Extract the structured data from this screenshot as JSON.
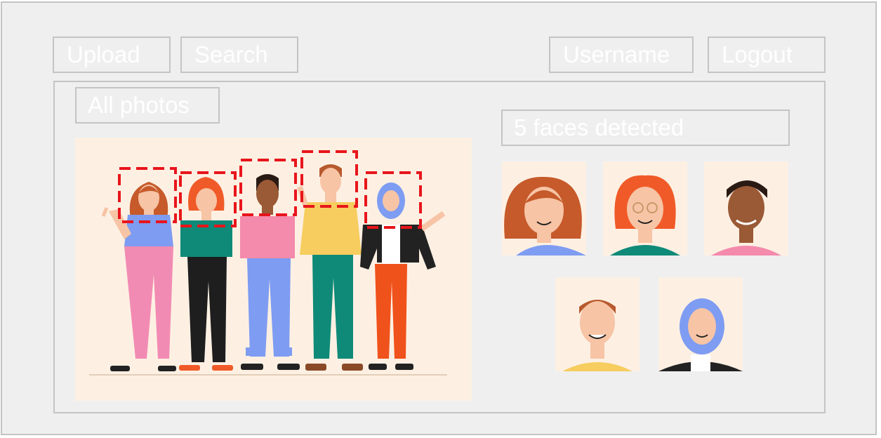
{
  "toolbar": {
    "upload_label": "Upload",
    "search_label": "Search",
    "username_label": "Username",
    "logout_label": "Logout"
  },
  "main": {
    "album_label": "All photos",
    "faces_status": "5 faces detected"
  },
  "colors": {
    "frame_bg": "#efefef",
    "border": "#c4c4c4",
    "button_text": "#ffffff",
    "detection_box": "#e8151b",
    "photo_bg": "#fdf0e3"
  },
  "icons": [
    "face-detection-box",
    "face-thumbnail"
  ]
}
